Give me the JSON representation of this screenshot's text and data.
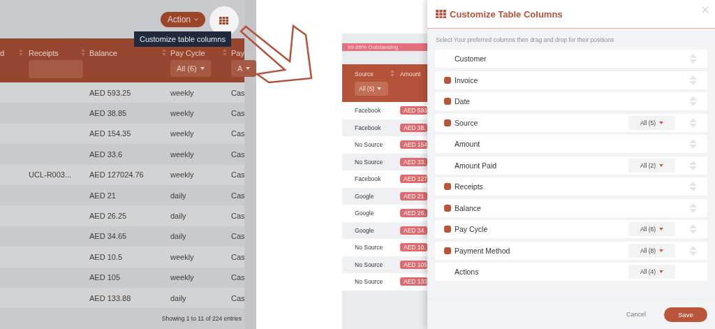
{
  "left_screen": {
    "action_button": "Action",
    "tooltip": "Customize table columns",
    "columns": [
      {
        "label": "d",
        "sortable": true
      },
      {
        "label": "Receipts",
        "sortable": true,
        "filter": {
          "kind": "input"
        }
      },
      {
        "label": "Balance",
        "sortable": true
      },
      {
        "label": "Pay Cycle",
        "sortable": true,
        "filter": {
          "kind": "select",
          "value": "All (6)"
        }
      },
      {
        "label": "Pay",
        "sortable": false,
        "filter": {
          "kind": "select",
          "value": "A"
        }
      }
    ],
    "rows": [
      {
        "balance": "AED 593.25",
        "pay_cycle": "weekly",
        "column_5": "Cas"
      },
      {
        "balance": "AED 38.85",
        "pay_cycle": "weekly",
        "column_5": "Cas"
      },
      {
        "balance": "AED 154.35",
        "pay_cycle": "weekly",
        "column_5": "Cas"
      },
      {
        "balance": "AED 33.6",
        "pay_cycle": "weekly",
        "column_5": "Cas"
      },
      {
        "receipts": "UCL-R003...",
        "balance": "AED 127024.76",
        "pay_cycle": "weekly",
        "column_5": "Cas"
      },
      {
        "balance": "AED 21",
        "pay_cycle": "daily",
        "column_5": "Cas"
      },
      {
        "balance": "AED 26.25",
        "pay_cycle": "daily",
        "column_5": "Cas"
      },
      {
        "balance": "AED 34.65",
        "pay_cycle": "daily",
        "column_5": "Cas"
      },
      {
        "balance": "AED 10.5",
        "pay_cycle": "weekly",
        "column_5": "Cas"
      },
      {
        "balance": "AED 105",
        "pay_cycle": "weekly",
        "column_5": "Cas"
      },
      {
        "balance": "AED 133.88",
        "pay_cycle": "daily",
        "column_5": "Cas"
      }
    ],
    "footer": "Showing 1 to 11 of 224 entries"
  },
  "right_screen": {
    "outstanding": "99.89% Outstanding",
    "columns": [
      {
        "label": "Source",
        "sortable": true,
        "filter": "All (5)"
      },
      {
        "label": "Amount",
        "sortable": false
      }
    ],
    "rows": [
      {
        "source": "Facebook",
        "amount": "AED 593"
      },
      {
        "source": "Facebook",
        "amount": "AED 38."
      },
      {
        "source": "No Source",
        "amount": "AED 154"
      },
      {
        "source": "No Source",
        "amount": "AED 33."
      },
      {
        "source": "Facebook",
        "amount": "AED 127"
      },
      {
        "source": "Google",
        "amount": "AED 21"
      },
      {
        "source": "Google",
        "amount": "AED 26."
      },
      {
        "source": "Google",
        "amount": "AED 34."
      },
      {
        "source": "No Source",
        "amount": "AED 10."
      },
      {
        "source": "No Source",
        "amount": "AED 105"
      },
      {
        "source": "No Source",
        "amount": "AED 133"
      }
    ],
    "modal": {
      "title": "Customize Table Columns",
      "subtitle": "Select Your preferred columns then drag and drop for their positions",
      "items": [
        {
          "label": "Customer",
          "checked": false,
          "draggable": true
        },
        {
          "label": "Invoice",
          "checked": true,
          "draggable": true
        },
        {
          "label": "Date",
          "checked": true,
          "draggable": true
        },
        {
          "label": "Source",
          "checked": true,
          "draggable": true,
          "filter": "All (5)"
        },
        {
          "label": "Amount",
          "checked": false,
          "draggable": true
        },
        {
          "label": "Amount Paid",
          "checked": false,
          "draggable": true,
          "filter": "All (2)"
        },
        {
          "label": "Receipts",
          "checked": true,
          "draggable": true
        },
        {
          "label": "Balance",
          "checked": true,
          "draggable": true
        },
        {
          "label": "Pay Cycle",
          "checked": true,
          "draggable": true,
          "filter": "All (6)"
        },
        {
          "label": "Payment Method",
          "checked": true,
          "draggable": true,
          "filter": "All (8)"
        },
        {
          "label": "Actions",
          "checked": false,
          "draggable": false,
          "filter": "All (4)"
        }
      ],
      "cancel": "Cancel",
      "save": "Save"
    }
  }
}
